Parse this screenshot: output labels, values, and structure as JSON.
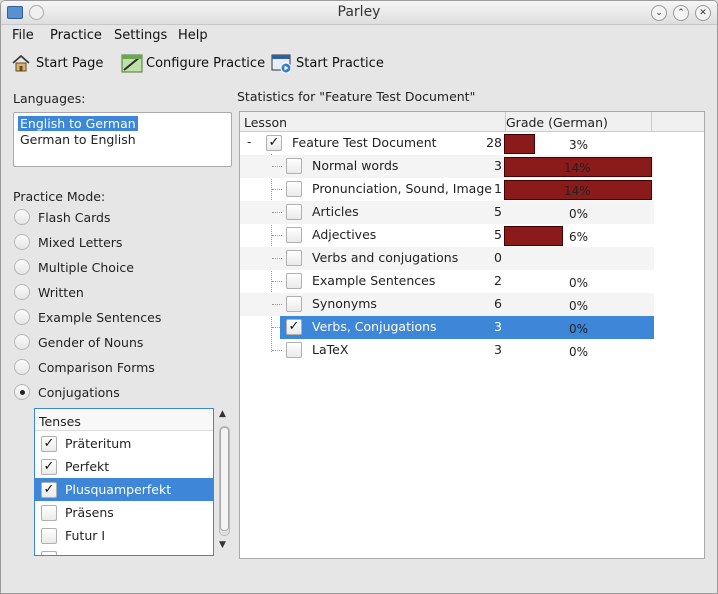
{
  "window": {
    "title": "Parley"
  },
  "menu": [
    "File",
    "Practice",
    "Settings",
    "Help"
  ],
  "toolbar": {
    "start_page": "Start Page",
    "configure_practice": "Configure Practice",
    "start_practice": "Start Practice"
  },
  "languages": {
    "label": "Languages:",
    "items": [
      "English to German",
      "German to English"
    ],
    "selected": 0
  },
  "practice_mode": {
    "label": "Practice Mode:",
    "options": [
      "Flash Cards",
      "Mixed Letters",
      "Multiple Choice",
      "Written",
      "Example Sentences",
      "Gender of Nouns",
      "Comparison Forms",
      "Conjugations"
    ],
    "selected": "Conjugations"
  },
  "tenses": {
    "header": "Tenses",
    "items": [
      {
        "label": "Präteritum",
        "checked": true
      },
      {
        "label": "Perfekt",
        "checked": true
      },
      {
        "label": "Plusquamperfekt",
        "checked": true,
        "selected": true
      },
      {
        "label": "Präsens",
        "checked": false
      },
      {
        "label": "Futur I",
        "checked": false
      }
    ]
  },
  "statistics": {
    "title": "Statistics for \"Feature Test Document\"",
    "columns": {
      "lesson": "Lesson",
      "grade": "Grade (German)"
    },
    "rows": [
      {
        "name": "Feature Test Document",
        "count": "28",
        "checked": true,
        "grade_pct": 3,
        "grade_label": "3%",
        "level": 0
      },
      {
        "name": "Normal words",
        "count": "3",
        "checked": false,
        "grade_pct": 14,
        "grade_label": "14%",
        "level": 1
      },
      {
        "name": "Pronunciation, Sound, Image",
        "count": "1",
        "checked": false,
        "grade_pct": 14,
        "grade_label": "14%",
        "level": 1
      },
      {
        "name": "Articles",
        "count": "5",
        "checked": false,
        "grade_pct": 0,
        "grade_label": "0%",
        "level": 1
      },
      {
        "name": "Adjectives",
        "count": "5",
        "checked": false,
        "grade_pct": 6,
        "grade_label": "6%",
        "level": 1
      },
      {
        "name": "Verbs and conjugations",
        "count": "0",
        "checked": false,
        "grade_pct": null,
        "grade_label": "",
        "level": 1
      },
      {
        "name": "Example Sentences",
        "count": "2",
        "checked": false,
        "grade_pct": 0,
        "grade_label": "0%",
        "level": 1
      },
      {
        "name": "Synonyms",
        "count": "6",
        "checked": false,
        "grade_pct": 0,
        "grade_label": "0%",
        "level": 1
      },
      {
        "name": "Verbs, Conjugations",
        "count": "3",
        "checked": true,
        "grade_pct": 0,
        "grade_label": "0%",
        "level": 1,
        "selected": true
      },
      {
        "name": "LaTeX",
        "count": "3",
        "checked": false,
        "grade_pct": 0,
        "grade_label": "0%",
        "level": 1
      }
    ]
  },
  "colors": {
    "accent": "#3d86d8",
    "grade_bar": "#8b1a1a"
  }
}
